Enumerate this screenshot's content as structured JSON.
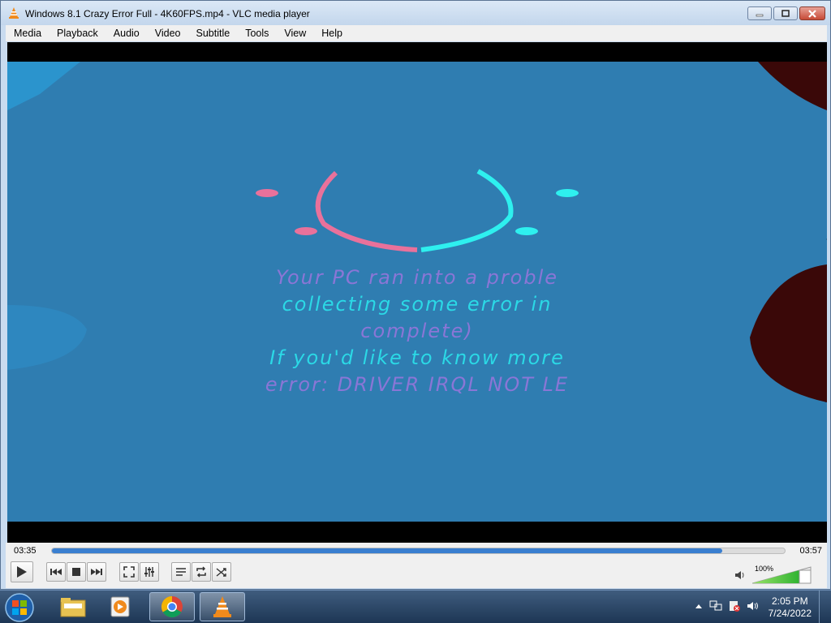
{
  "window": {
    "title": "Windows 8.1 Crazy Error Full - 4K60FPS.mp4 - VLC media player",
    "icon": "vlc-cone-icon"
  },
  "menu": [
    "Media",
    "Playback",
    "Audio",
    "Video",
    "Subtitle",
    "Tools",
    "View",
    "Help"
  ],
  "video": {
    "background_color": "#2f7db1",
    "overlay_lines": [
      "Your PC ran into a proble",
      "collecting some error in",
      "complete)",
      "If you'd like to know more",
      "error: DRIVER IRQL NOT LE"
    ]
  },
  "player": {
    "elapsed": "03:35",
    "total": "03:57",
    "progress": 0.915,
    "volume": "100%",
    "buttons": {
      "play": "play-icon",
      "prev": "previous-icon",
      "stop": "stop-icon",
      "next": "next-icon",
      "fullscreen": "fullscreen-icon",
      "extended": "extended-settings-icon",
      "playlist": "playlist-icon",
      "loop": "loop-icon",
      "shuffle": "shuffle-icon"
    }
  },
  "taskbar": {
    "clock_time": "2:05 PM",
    "clock_date": "7/24/2022",
    "apps": [
      "windows-explorer-icon",
      "media-player-icon",
      "chrome-icon",
      "vlc-cone-icon"
    ]
  }
}
